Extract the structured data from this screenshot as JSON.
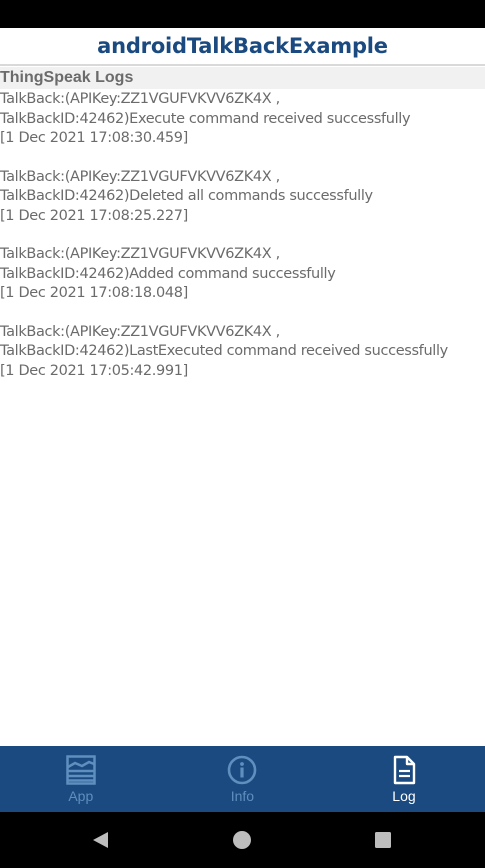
{
  "app": {
    "title": "androidTalkBackExample"
  },
  "log_section": {
    "title": "ThingSpeak Logs",
    "entries": [
      {
        "line1": "TalkBack:(APIKey:ZZ1VGUFVKVV6ZK4X ,",
        "line2": "TalkBackID:42462)Execute command received successfully",
        "line3": "[1 Dec 2021 17:08:30.459]"
      },
      {
        "line1": "TalkBack:(APIKey:ZZ1VGUFVKVV6ZK4X ,",
        "line2": "TalkBackID:42462)Deleted all commands successfully",
        "line3": "[1 Dec 2021 17:08:25.227]"
      },
      {
        "line1": "TalkBack:(APIKey:ZZ1VGUFVKVV6ZK4X ,",
        "line2": "TalkBackID:42462)Added command successfully",
        "line3": "[1 Dec 2021 17:08:18.048]"
      },
      {
        "line1": "TalkBack:(APIKey:ZZ1VGUFVKVV6ZK4X ,",
        "line2": "TalkBackID:42462)LastExecuted command received successfully",
        "line3": "[1 Dec 2021 17:05:42.991]"
      }
    ]
  },
  "bottom_nav": {
    "items": [
      {
        "label": "App",
        "icon": "chart-layers-icon",
        "active": false
      },
      {
        "label": "Info",
        "icon": "info-circle-icon",
        "active": false
      },
      {
        "label": "Log",
        "icon": "document-icon",
        "active": true
      }
    ]
  },
  "system_nav": {
    "buttons": [
      "back",
      "home",
      "recents"
    ]
  },
  "colors": {
    "brand": "#1a4a7f",
    "nav_inactive": "#5f8fbf",
    "nav_active": "#ffffff",
    "log_text": "#6b6b6b"
  }
}
